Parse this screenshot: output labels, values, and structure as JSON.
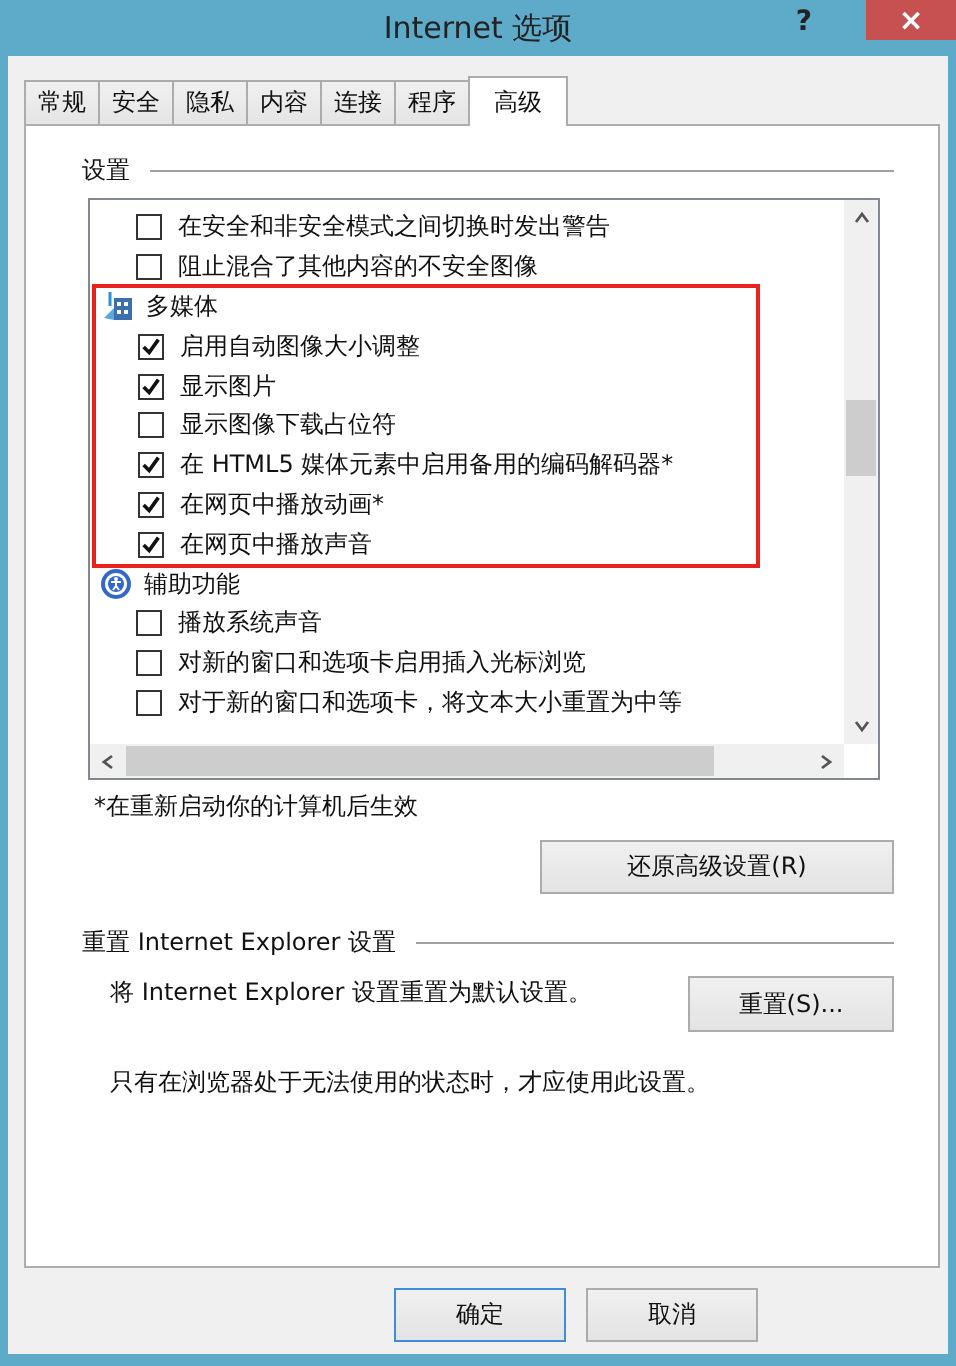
{
  "window": {
    "title": "Internet 选项"
  },
  "title_buttons": {
    "help": "?",
    "close": "×"
  },
  "tabs": [
    {
      "label": "常规",
      "selected": false
    },
    {
      "label": "安全",
      "selected": false
    },
    {
      "label": "隐私",
      "selected": false
    },
    {
      "label": "内容",
      "selected": false
    },
    {
      "label": "连接",
      "selected": false
    },
    {
      "label": "程序",
      "selected": false
    },
    {
      "label": "高级",
      "selected": true
    }
  ],
  "settings": {
    "heading": "设置",
    "items": [
      {
        "kind": "checkbox",
        "label": "在安全和非安全模式之间切换时发出警告",
        "checked": false,
        "highlighted": false
      },
      {
        "kind": "checkbox",
        "label": "阻止混合了其他内容的不安全图像",
        "checked": false,
        "highlighted": false
      },
      {
        "kind": "group",
        "label": "多媒体",
        "highlighted": true
      },
      {
        "kind": "checkbox",
        "label": "启用自动图像大小调整",
        "checked": true,
        "highlighted": true
      },
      {
        "kind": "checkbox",
        "label": "显示图片",
        "checked": true,
        "highlighted": true
      },
      {
        "kind": "checkbox",
        "label": "显示图像下载占位符",
        "checked": false,
        "highlighted": true
      },
      {
        "kind": "checkbox",
        "label": "在 HTML5 媒体元素中启用备用的编码解码器*",
        "checked": true,
        "highlighted": true
      },
      {
        "kind": "checkbox",
        "label": "在网页中播放动画*",
        "checked": true,
        "highlighted": true
      },
      {
        "kind": "checkbox",
        "label": "在网页中播放声音",
        "checked": true,
        "highlighted": true
      },
      {
        "kind": "group",
        "label": "辅助功能",
        "highlighted": false
      },
      {
        "kind": "checkbox",
        "label": "播放系统声音",
        "checked": false,
        "highlighted": false
      },
      {
        "kind": "checkbox",
        "label": "对新的窗口和选项卡启用插入光标浏览",
        "checked": false,
        "highlighted": false
      },
      {
        "kind": "checkbox",
        "label": "对于新的窗口和选项卡，将文本大小重置为中等",
        "checked": false,
        "highlighted": false
      }
    ],
    "note": "*在重新启动你的计算机后生效",
    "restore_button": "还原高级设置(R)"
  },
  "reset": {
    "heading": "重置 Internet Explorer 设置",
    "description": "将 Internet Explorer 设置重置为默认设置。",
    "button": "重置(S)...",
    "note": "只有在浏览器处于无法使用的状态时，才应使用此设置。"
  },
  "buttons": [
    {
      "label": "确定",
      "selected": true
    },
    {
      "label": "取消",
      "selected": false
    }
  ]
}
